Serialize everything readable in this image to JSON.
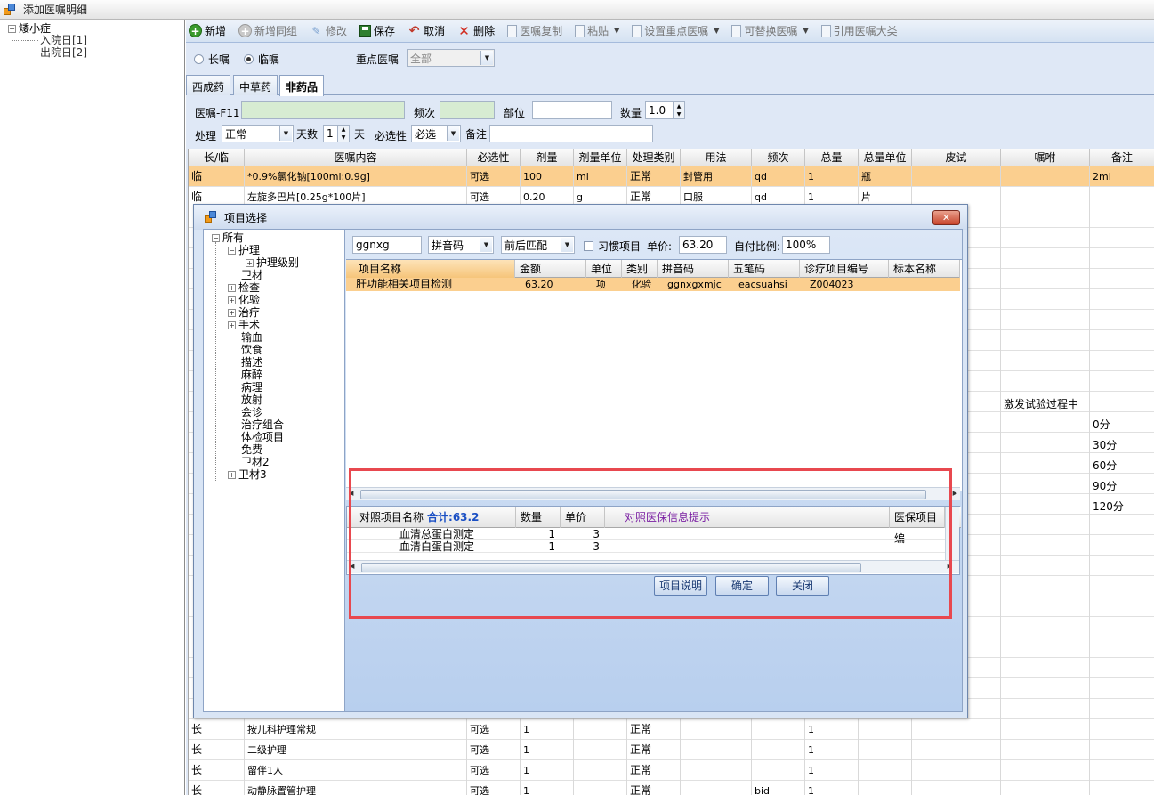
{
  "window": {
    "title": "添加医嘱明细"
  },
  "left_tree": {
    "root": "矮小症",
    "children": [
      "入院日[1]",
      "出院日[2]"
    ]
  },
  "toolbar": {
    "buttons": [
      {
        "name": "add",
        "label": "新增",
        "icon": "add-icon",
        "enabled": true
      },
      {
        "name": "add-group",
        "label": "新增同组",
        "icon": "add-group-icon",
        "enabled": false
      },
      {
        "name": "edit",
        "label": "修改",
        "icon": "edit-icon",
        "enabled": false
      },
      {
        "name": "save",
        "label": "保存",
        "icon": "save-icon",
        "enabled": true
      },
      {
        "name": "cancel",
        "label": "取消",
        "icon": "undo-icon",
        "enabled": true
      },
      {
        "name": "delete",
        "label": "删除",
        "icon": "delete-icon",
        "enabled": true
      },
      {
        "name": "copy",
        "label": "医嘱复制",
        "icon": "copy-icon",
        "enabled": false
      },
      {
        "name": "paste",
        "label": "粘贴",
        "icon": "paste-icon",
        "enabled": false,
        "dropdown": true
      },
      {
        "name": "set-key",
        "label": "设置重点医嘱",
        "icon": "doc-icon",
        "enabled": false,
        "dropdown": true
      },
      {
        "name": "replace",
        "label": "可替换医嘱",
        "icon": "doc-icon",
        "enabled": false,
        "dropdown": true
      },
      {
        "name": "cite",
        "label": "引用医嘱大类",
        "icon": "doc-icon",
        "enabled": false
      }
    ]
  },
  "order_type": {
    "long_label": "长嘱",
    "temp_label": "临嘱",
    "selected": "temp"
  },
  "key_order": {
    "label": "重点医嘱",
    "value": "全部"
  },
  "tabs": [
    {
      "label": "西成药",
      "active": false
    },
    {
      "label": "中草药",
      "active": false
    },
    {
      "label": "非药品",
      "active": true
    }
  ],
  "form": {
    "order_label": "医嘱-F11",
    "order_value": "",
    "freq_label": "频次",
    "freq_value": "",
    "site_label": "部位",
    "site_value": "",
    "qty_label": "数量",
    "qty_value": "1.0",
    "process_label": "处理",
    "process_value": "正常",
    "days_label": "天数",
    "days_value": "1",
    "days_unit": "天",
    "optional_label": "必选性",
    "optional_value": "必选",
    "note_label": "备注",
    "note_value": ""
  },
  "grid": {
    "columns": [
      "长/临",
      "医嘱内容",
      "必选性",
      "剂量",
      "剂量单位",
      "处理类别",
      "用法",
      "频次",
      "总量",
      "总量单位",
      "皮试",
      "嘱咐",
      "备注"
    ],
    "top_rows": [
      {
        "cells": [
          "临",
          "*0.9%氯化钠[100ml:0.9g]",
          "可选",
          "100",
          "ml",
          "正常",
          "封管用",
          "qd",
          "1",
          "瓶",
          "",
          "",
          "2ml"
        ],
        "selected": true
      },
      {
        "cells": [
          "临",
          "左旋多巴片[0.25g*100片]",
          "可选",
          "0.20",
          "g",
          "正常",
          "口服",
          "qd",
          "1",
          "片",
          "",
          "",
          ""
        ],
        "selected": false
      }
    ],
    "side_text": [
      "激发试验过程中",
      "0分",
      "30分",
      "60分",
      "90分",
      "120分"
    ],
    "bottom_rows": [
      [
        "长",
        "按儿科护理常规",
        "可选",
        "1",
        "",
        "正常",
        "",
        "",
        "1",
        "",
        "",
        "",
        ""
      ],
      [
        "长",
        "二级护理",
        "可选",
        "1",
        "",
        "正常",
        "",
        "",
        "1",
        "",
        "",
        "",
        ""
      ],
      [
        "长",
        "留伴1人",
        "可选",
        "1",
        "",
        "正常",
        "",
        "",
        "1",
        "",
        "",
        "",
        ""
      ],
      [
        "长",
        "动静脉置管护理",
        "可选",
        "1",
        "",
        "正常",
        "",
        "bid",
        "1",
        "",
        "",
        "",
        ""
      ]
    ]
  },
  "dialog": {
    "title": "项目选择",
    "tree": {
      "root": "所有",
      "nursing": "护理",
      "nursing_child": "护理级别",
      "items": [
        "卫材",
        "检查",
        "化验",
        "治疗",
        "手术",
        "输血",
        "饮食",
        "描述",
        "麻醉",
        "病理",
        "放射",
        "会诊",
        "治疗组合",
        "体检项目",
        "免费",
        "卫材2",
        "卫材3"
      ]
    },
    "search_value": "ggnxg",
    "code_type": "拼音码",
    "match_type": "前后匹配",
    "habit_label": "习惯项目",
    "unit_price_label": "单价:",
    "unit_price_value": "63.20",
    "self_pay_label": "自付比例:",
    "self_pay_value": "100%",
    "columns": [
      "项目名称",
      "金额",
      "单位",
      "类别",
      "拼音码",
      "五笔码",
      "诊疗项目编号",
      "标本名称"
    ],
    "rows": [
      [
        "肝功能相关项目检测",
        "63.20",
        "项",
        "化验",
        "ggnxgxmjc",
        "eacsuahsi",
        "Z004023",
        ""
      ]
    ],
    "sub_columns": [
      "对照项目名称",
      "数量",
      "单价",
      "对照医保信息提示",
      "医保项目编"
    ],
    "sub_total": "合计:63.2",
    "sub_rows": [
      [
        "血清总蛋白测定",
        "1",
        "3"
      ],
      [
        "血清白蛋白测定",
        "1",
        "3"
      ]
    ],
    "buttons": {
      "info": "项目说明",
      "ok": "确定",
      "close": "关闭"
    }
  }
}
